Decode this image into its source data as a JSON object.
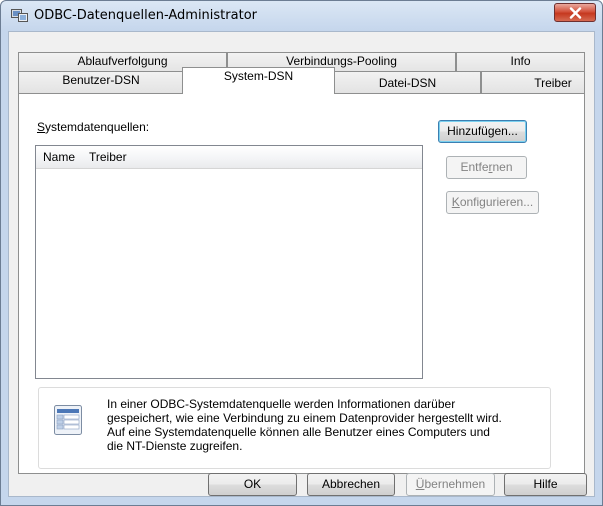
{
  "window": {
    "title": "ODBC-Datenquellen-Administrator",
    "icon": "odbc-app-icon",
    "close_icon": "close-x-icon"
  },
  "tabs": {
    "row_back": [
      {
        "label": "Ablaufverfolgung"
      },
      {
        "label": "Verbindungs-Pooling"
      },
      {
        "label": "Info"
      }
    ],
    "row_front": [
      {
        "label": "Benutzer-DSN"
      },
      {
        "label": "System-DSN",
        "active": true
      },
      {
        "label": "Datei-DSN"
      },
      {
        "label": "Treiber"
      }
    ]
  },
  "panel": {
    "list_label_first": "S",
    "list_label_rest": "ystemdatenquellen:",
    "columns": [
      "Name",
      "Treiber"
    ],
    "rows": [],
    "buttons": {
      "add": "Hinzufügen...",
      "remove_pre": "Entfe",
      "remove_u": "r",
      "remove_post": "nen",
      "configure_u": "K",
      "configure_rest": "onfigurieren..."
    },
    "info": {
      "icon": "data-source-icon",
      "lines": [
        "In einer ODBC-Systemdatenquelle werden Informationen darüber",
        "gespeichert, wie eine Verbindung zu einem Datenprovider hergestellt wird.",
        "Auf eine Systemdatenquelle können alle Benutzer eines Computers und",
        "die NT-Dienste zugreifen."
      ]
    }
  },
  "footer": {
    "ok": "OK",
    "cancel": "Abbrechen",
    "apply_u": "Ü",
    "apply_rest": "bernehmen",
    "help": "Hilfe"
  }
}
